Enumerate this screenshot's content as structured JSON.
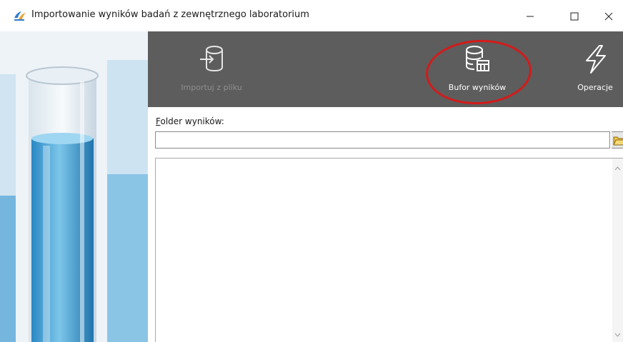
{
  "window": {
    "title": "Importowanie wyników badań z zewnętrznego laboratorium",
    "minimize": "—",
    "maximize": "☐",
    "close": "✕"
  },
  "toolbar": {
    "import_label": "Importuj z pliku",
    "buffer_label": "Bufor wyników",
    "operations_label": "Operacje",
    "import_icon": "database-import-icon",
    "buffer_icon": "database-table-icon",
    "operations_icon": "lightning-icon"
  },
  "folder": {
    "label_accel": "F",
    "label_rest": "older wyników:",
    "value": ""
  },
  "colors": {
    "toolbar_bg": "#5d5d5d",
    "highlight_circle": "#d31b1b",
    "disabled_text": "#8f8f8f"
  }
}
